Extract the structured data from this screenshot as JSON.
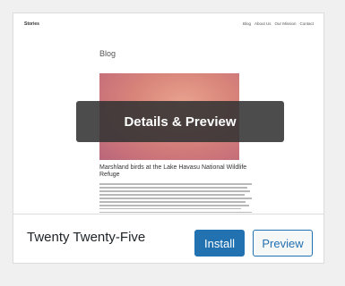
{
  "theme_card": {
    "site": {
      "title": "Stories",
      "nav": [
        "Blog",
        "About Us",
        "Our Mission",
        "Contact"
      ],
      "page_heading": "Blog",
      "post_title": "Marshland birds at the Lake Havasu National Wildlife Refuge"
    },
    "overlay_label": "Details & Preview",
    "name": "Twenty Twenty-Five",
    "install_label": "Install",
    "preview_label": "Preview"
  }
}
